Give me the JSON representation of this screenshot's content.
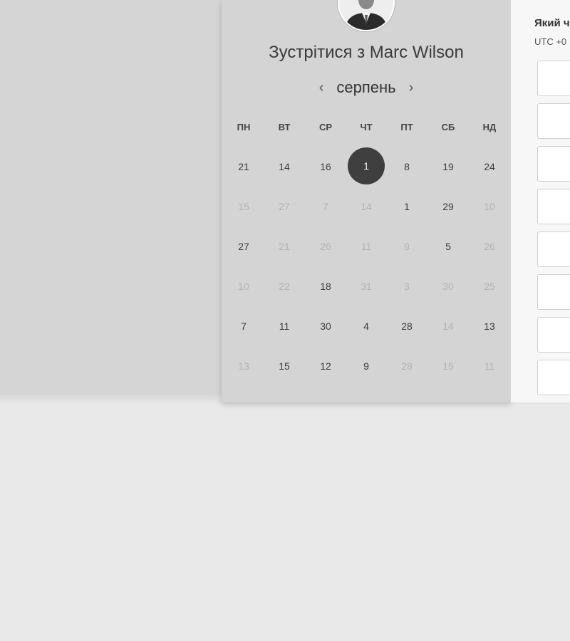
{
  "calendar": {
    "title": "Зустрітися з Marc Wilson",
    "month": "серпень",
    "prev_icon": "chevron-left-icon",
    "next_icon": "chevron-right-icon",
    "weekdays": [
      "ПН",
      "ВТ",
      "СР",
      "ЧТ",
      "ПТ",
      "СБ",
      "НД"
    ],
    "weeks": [
      [
        {
          "d": "21",
          "m": false
        },
        {
          "d": "14",
          "m": false
        },
        {
          "d": "16",
          "m": false
        },
        {
          "d": "1",
          "m": false,
          "sel": true
        },
        {
          "d": "8",
          "m": false
        },
        {
          "d": "19",
          "m": false
        },
        {
          "d": "24",
          "m": false
        }
      ],
      [
        {
          "d": "15",
          "m": true
        },
        {
          "d": "27",
          "m": true
        },
        {
          "d": "7",
          "m": true
        },
        {
          "d": "14",
          "m": true
        },
        {
          "d": "1",
          "m": false
        },
        {
          "d": "29",
          "m": false
        },
        {
          "d": "10",
          "m": true
        }
      ],
      [
        {
          "d": "27",
          "m": false
        },
        {
          "d": "21",
          "m": true
        },
        {
          "d": "26",
          "m": true
        },
        {
          "d": "11",
          "m": true
        },
        {
          "d": "9",
          "m": true
        },
        {
          "d": "5",
          "m": false
        },
        {
          "d": "26",
          "m": true
        }
      ],
      [
        {
          "d": "10",
          "m": true
        },
        {
          "d": "22",
          "m": true
        },
        {
          "d": "18",
          "m": false
        },
        {
          "d": "31",
          "m": true
        },
        {
          "d": "3",
          "m": true
        },
        {
          "d": "30",
          "m": true
        },
        {
          "d": "25",
          "m": true
        }
      ],
      [
        {
          "d": "7",
          "m": false
        },
        {
          "d": "11",
          "m": false
        },
        {
          "d": "30",
          "m": false
        },
        {
          "d": "4",
          "m": false
        },
        {
          "d": "28",
          "m": false
        },
        {
          "d": "14",
          "m": true
        },
        {
          "d": "13",
          "m": false
        }
      ],
      [
        {
          "d": "13",
          "m": true
        },
        {
          "d": "15",
          "m": false
        },
        {
          "d": "12",
          "m": false
        },
        {
          "d": "9",
          "m": false
        },
        {
          "d": "28",
          "m": true
        },
        {
          "d": "15",
          "m": true
        },
        {
          "d": "11",
          "m": true
        }
      ]
    ]
  },
  "time_panel": {
    "title": "Який ч",
    "timezone": "UTC +0",
    "slot_count": 8
  },
  "colors": {
    "selected_day": "#3f3f3f",
    "muted_day": "#b3b3b3",
    "card_bg": "#d4d4d4",
    "page_bg": "#e9e9e9"
  }
}
